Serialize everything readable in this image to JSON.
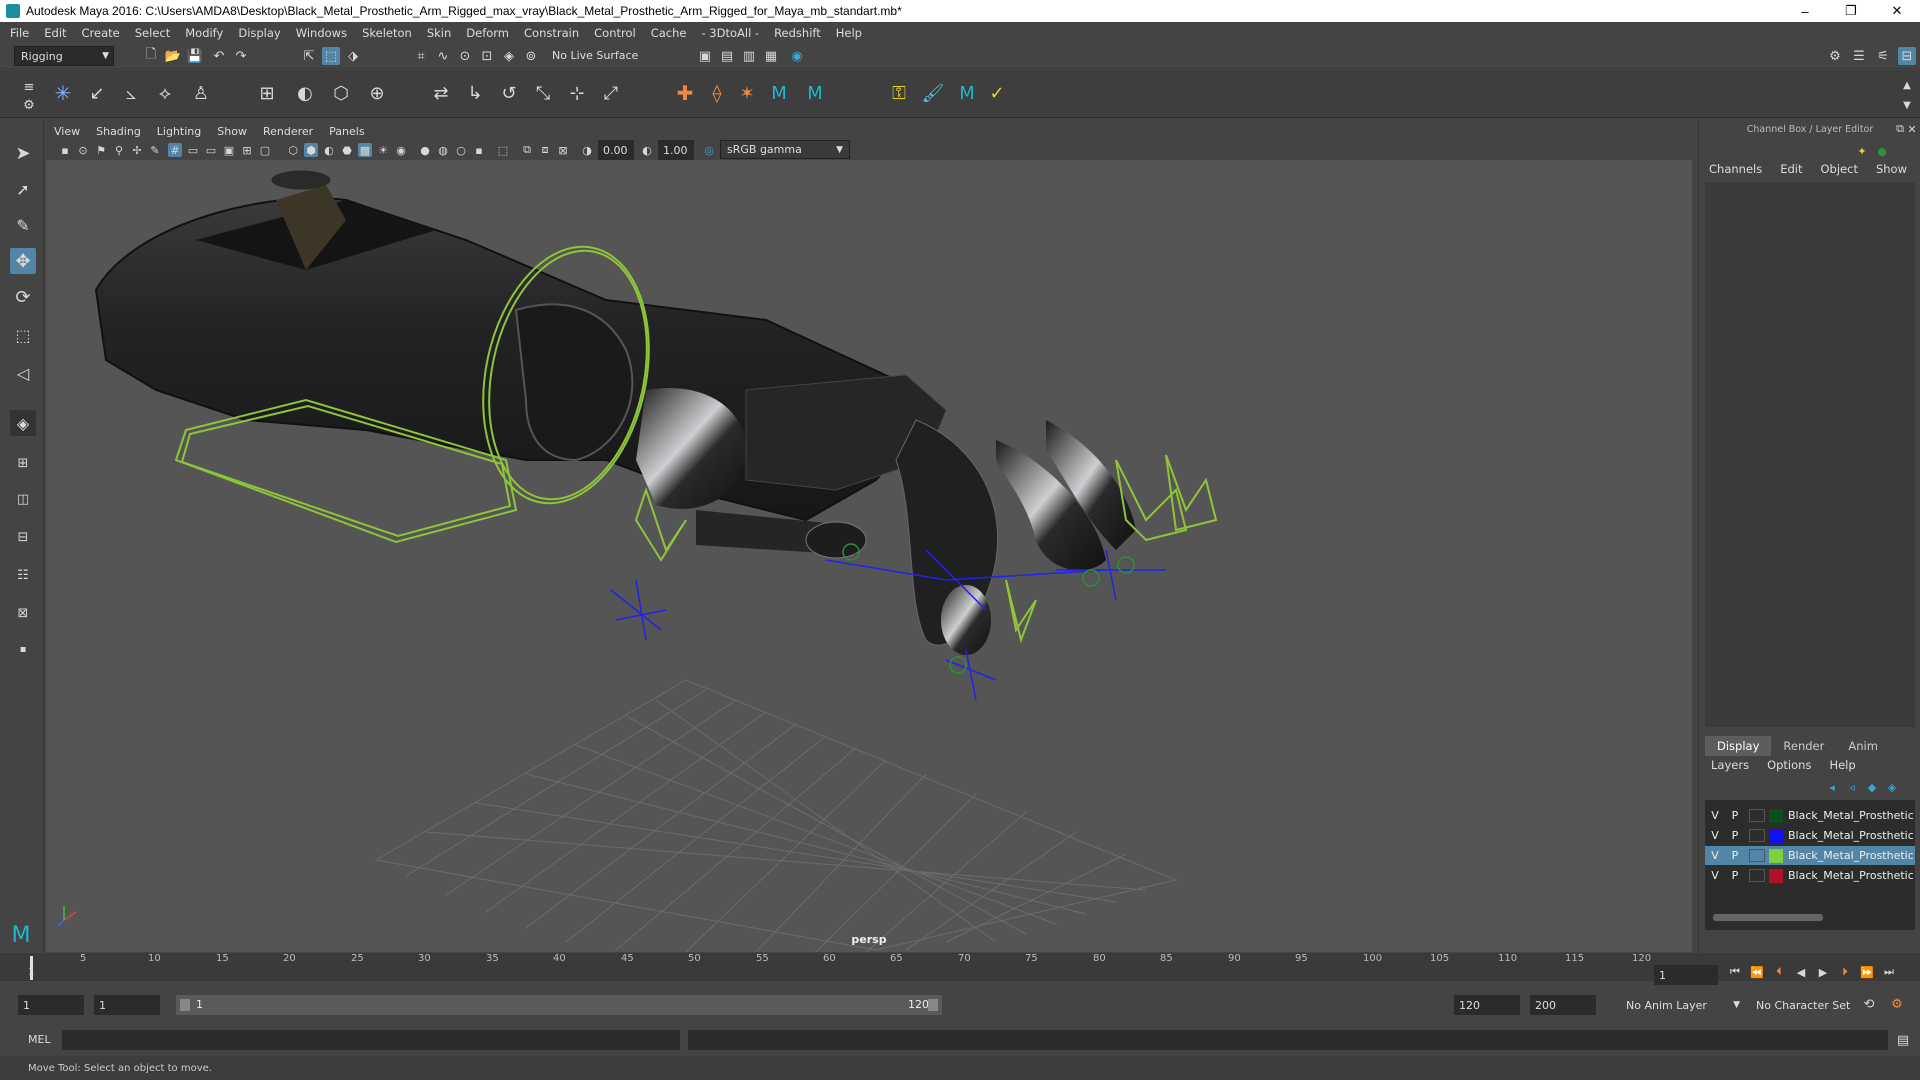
{
  "window": {
    "title": "Autodesk Maya 2016: C:\\Users\\AMDA8\\Desktop\\Black_Metal_Prosthetic_Arm_Rigged_max_vray\\Black_Metal_Prosthetic_Arm_Rigged_for_Maya_mb_standart.mb*",
    "minimize": "–",
    "restore": "❐",
    "close": "✕"
  },
  "menubar": [
    "File",
    "Edit",
    "Create",
    "Select",
    "Modify",
    "Display",
    "Windows",
    "Skeleton",
    "Skin",
    "Deform",
    "Constrain",
    "Control",
    "Cache",
    "- 3DtoAll -",
    "Redshift",
    "Help"
  ],
  "statusline": {
    "mode": "Rigging",
    "live_surface": "No Live Surface"
  },
  "viewport_menu": [
    "View",
    "Shading",
    "Lighting",
    "Show",
    "Renderer",
    "Panels"
  ],
  "panel_toolbar": {
    "exposure": "0.00",
    "gamma": "1.00",
    "color_space": "sRGB gamma"
  },
  "viewport": {
    "camera": "persp"
  },
  "channel_box": {
    "title": "Channel Box / Layer Editor",
    "menus": [
      "Channels",
      "Edit",
      "Object",
      "Show"
    ]
  },
  "layer_editor": {
    "tabs": [
      "Display",
      "Render",
      "Anim"
    ],
    "active_tab": "Display",
    "menus": [
      "Layers",
      "Options",
      "Help"
    ],
    "layers": [
      {
        "v": "V",
        "p": "P",
        "name": "Black_Metal_Prosthetic",
        "color": "#0b4f1f",
        "selected": false
      },
      {
        "v": "V",
        "p": "P",
        "name": "Black_Metal_Prosthetic",
        "color": "#1010ee",
        "selected": false
      },
      {
        "v": "V",
        "p": "P",
        "name": "Black_Metal_Prosthetic",
        "color": "#7fcf3f",
        "selected": true
      },
      {
        "v": "V",
        "p": "P",
        "name": "Black_Metal_Prosthetic",
        "color": "#b0102a",
        "selected": false
      }
    ]
  },
  "timeline": {
    "ticks": [
      "1",
      "5",
      "10",
      "15",
      "20",
      "25",
      "30",
      "35",
      "40",
      "45",
      "50",
      "55",
      "60",
      "65",
      "70",
      "75",
      "80",
      "85",
      "90",
      "95",
      "100",
      "105",
      "110",
      "115",
      "120"
    ],
    "current_frame": "1"
  },
  "range": {
    "start": "1",
    "playback_start": "1",
    "slider_start": "1",
    "slider_end": "120",
    "playback_end": "120",
    "end": "200",
    "anim_layer": "No Anim Layer",
    "character_set": "No Character Set"
  },
  "commandline": {
    "language": "MEL"
  },
  "helpline": {
    "text": "Move Tool: Select an object to move."
  }
}
